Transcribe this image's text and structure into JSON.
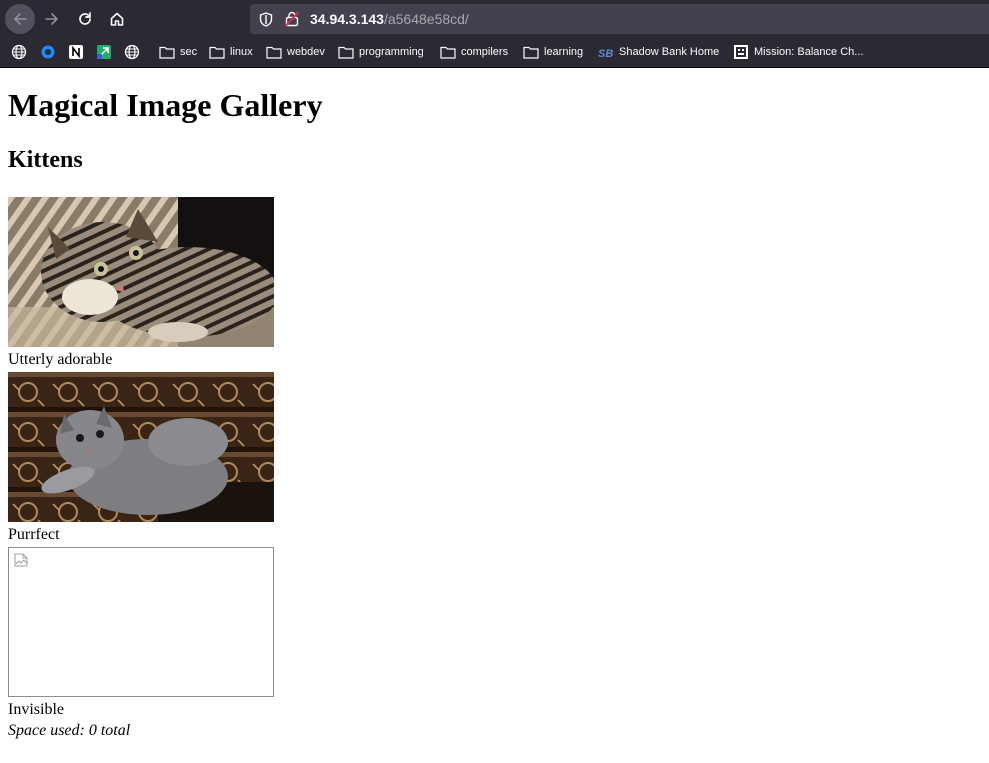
{
  "browser": {
    "url_host": "34.94.3.143",
    "url_path": "/a5648e58cd/",
    "bookmarks": [
      {
        "label": "sec",
        "icon": "folder-icon"
      },
      {
        "label": "linux",
        "icon": "folder-icon"
      },
      {
        "label": "webdev",
        "icon": "folder-icon"
      },
      {
        "label": "programming",
        "icon": "folder-icon"
      },
      {
        "label": "compilers",
        "icon": "folder-icon"
      },
      {
        "label": "learning",
        "icon": "folder-icon"
      },
      {
        "label": "Shadow Bank Home",
        "icon": "shadow-bank-icon"
      },
      {
        "label": "Mission: Balance Ch...",
        "icon": "mission-icon"
      }
    ],
    "colors": {
      "chrome": "#2b2a33",
      "urlbar": "#42414d",
      "text": "#fbfbfe"
    }
  },
  "page": {
    "title": "Magical Image Gallery",
    "subtitle": "Kittens",
    "items": [
      {
        "caption": "Utterly adorable",
        "image": "tabby-kitten-photo"
      },
      {
        "caption": "Purrfect",
        "image": "grey-kitten-photo"
      },
      {
        "caption": "Invisible",
        "image": "broken-image-icon"
      }
    ],
    "footer": "Space used: 0 total"
  }
}
